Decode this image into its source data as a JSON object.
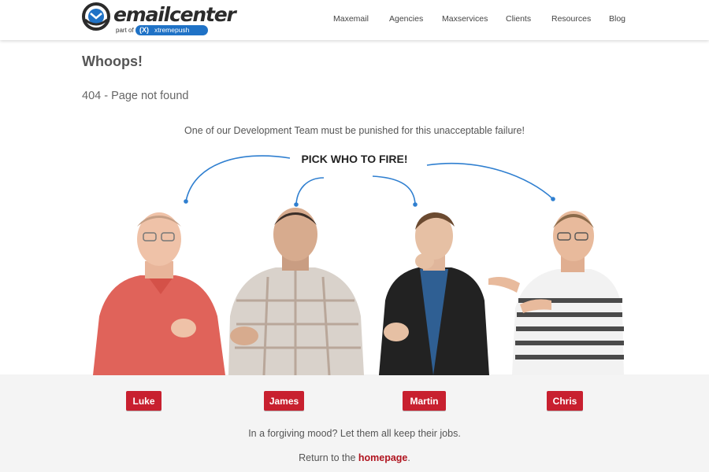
{
  "header": {
    "logo": {
      "wordmark": "emailcenter",
      "part_of": "part of",
      "partner": "xtremepush",
      "partner_mark": "(X)"
    },
    "nav": [
      {
        "label": "Maxemail"
      },
      {
        "label": "Agencies"
      },
      {
        "label": "Maxservices"
      },
      {
        "label": "Clients"
      },
      {
        "label": "Resources"
      },
      {
        "label": "Blog"
      }
    ]
  },
  "page": {
    "title": "Whoops!",
    "subtitle": "404 - Page not found",
    "lead": "One of our Development Team must be punished for this unacceptable failure!",
    "pick_heading": "PICK WHO TO FIRE!"
  },
  "team": [
    {
      "name": "Luke"
    },
    {
      "name": "James"
    },
    {
      "name": "Martin"
    },
    {
      "name": "Chris"
    }
  ],
  "footer": {
    "forgive_text": "In a forgiving mood? Let them all keep their jobs.",
    "return_prefix": "Return to the ",
    "return_link": "homepage",
    "return_suffix": "."
  },
  "colors": {
    "accent_red": "#c8202f",
    "arc_blue": "#2f7fd0",
    "link_red": "#b0141f",
    "logo_blue": "#1f72c6"
  }
}
